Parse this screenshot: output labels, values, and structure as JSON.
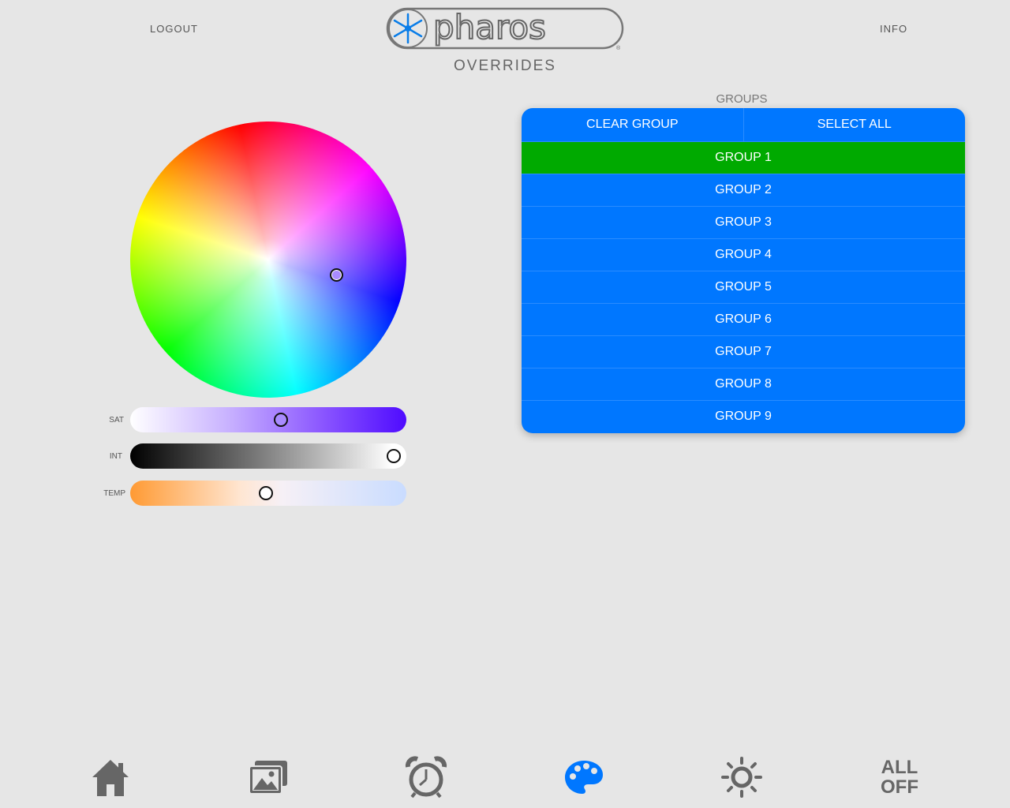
{
  "header": {
    "logout_label": "LOGOUT",
    "info_label": "INFO",
    "logo_text": "pharos",
    "logo_mark": "®",
    "page_title": "OVERRIDES"
  },
  "color_picker": {
    "selected_color": "#a98bff",
    "sliders": [
      {
        "label": "SAT",
        "value_fraction": 0.55
      },
      {
        "label": "INT",
        "value_fraction": 1.0
      },
      {
        "label": "TEMP",
        "value_fraction": 0.49
      }
    ]
  },
  "groups": {
    "title": "GROUPS",
    "clear_label": "CLEAR GROUP",
    "select_all_label": "SELECT ALL",
    "items": [
      {
        "label": "GROUP 1",
        "active": true
      },
      {
        "label": "GROUP 2",
        "active": false
      },
      {
        "label": "GROUP 3",
        "active": false
      },
      {
        "label": "GROUP 4",
        "active": false
      },
      {
        "label": "GROUP 5",
        "active": false
      },
      {
        "label": "GROUP 6",
        "active": false
      },
      {
        "label": "GROUP 7",
        "active": false
      },
      {
        "label": "GROUP 8",
        "active": false
      },
      {
        "label": "GROUP 9",
        "active": false
      }
    ]
  },
  "nav": {
    "items": [
      {
        "icon": "home-icon",
        "active": false
      },
      {
        "icon": "scenes-icon",
        "active": false
      },
      {
        "icon": "alarm-clock-icon",
        "active": false
      },
      {
        "icon": "palette-icon",
        "active": true
      },
      {
        "icon": "sun-icon",
        "active": false
      }
    ],
    "all_off_line1": "ALL",
    "all_off_line2": "OFF"
  },
  "colors": {
    "accent_blue": "#0077ff",
    "active_green": "#00aa00",
    "background": "#e6e6e6"
  }
}
